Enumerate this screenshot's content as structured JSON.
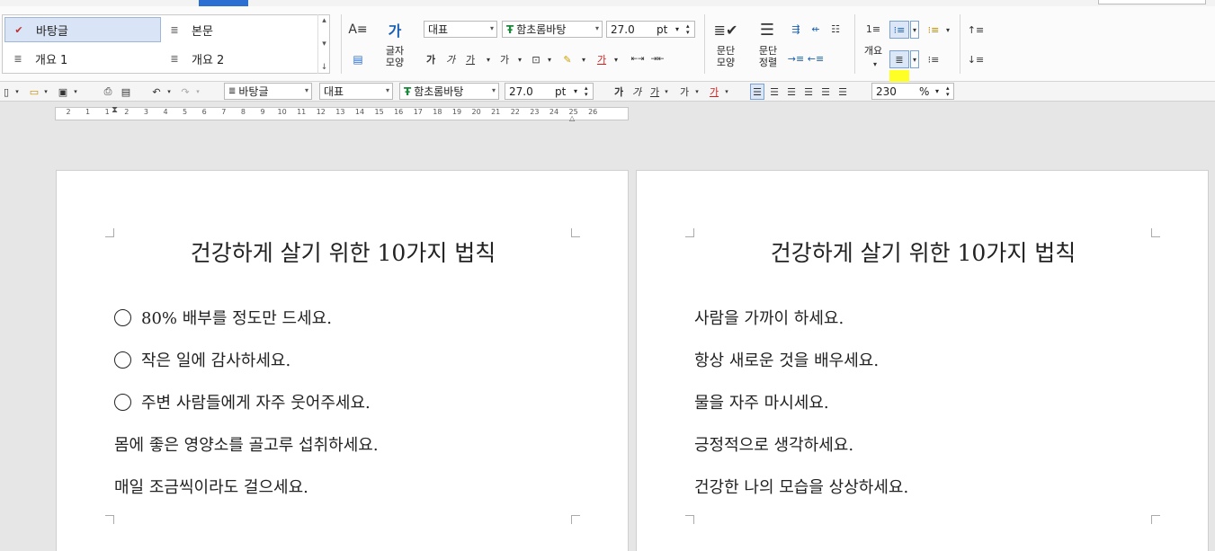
{
  "ribbon": {
    "styles": [
      {
        "label": "바탕글",
        "selected": true,
        "icon": "style-paragraph-icon"
      },
      {
        "label": "본문",
        "selected": false,
        "icon": "style-paragraph-icon"
      },
      {
        "label": "개요 1",
        "selected": false,
        "icon": "style-paragraph-icon"
      },
      {
        "label": "개요 2",
        "selected": false,
        "icon": "style-paragraph-icon"
      }
    ],
    "style_label": "바탕글",
    "language_combo": "대표",
    "font_combo": "함초롬바탕",
    "size_value": "27.0",
    "size_unit": "pt",
    "char_shape_label": "글자\n모양",
    "para_shape_label": "문단\n모양",
    "para_align_label": "문단\n정렬",
    "outline_label": "개요",
    "bold": "가",
    "italic": "가",
    "underline": "가"
  },
  "toolbar2": {
    "style_combo": "바탕글",
    "language_combo": "대표",
    "font_combo": "함초롬바탕",
    "size_value": "27.0",
    "size_unit": "pt",
    "zoom_value": "230",
    "zoom_unit": "%"
  },
  "ruler": {
    "ticks": [
      "2",
      "1",
      "1",
      "2",
      "3",
      "4",
      "5",
      "6",
      "7",
      "8",
      "9",
      "10",
      "11",
      "12",
      "13",
      "14",
      "15",
      "16",
      "17",
      "18",
      "19",
      "20",
      "21",
      "22",
      "23",
      "24",
      "25",
      "26"
    ]
  },
  "pages": [
    {
      "title": "건강하게 살기 위한 10가지 법칙",
      "lines": [
        {
          "text": "80% 배부를 정도만 드세요.",
          "bullet": true
        },
        {
          "text": "작은 일에 감사하세요.",
          "bullet": true
        },
        {
          "text": "주변 사람들에게 자주 웃어주세요.",
          "bullet": true
        },
        {
          "text": "몸에 좋은 영양소를 골고루 섭취하세요.",
          "bullet": false
        },
        {
          "text": "매일 조금씩이라도 걸으세요.",
          "bullet": false
        }
      ]
    },
    {
      "title": "건강하게 살기 위한 10가지 법칙",
      "lines": [
        {
          "text": "사람을 가까이 하세요.",
          "bullet": false
        },
        {
          "text": "항상 새로운 것을 배우세요.",
          "bullet": false
        },
        {
          "text": "물을 자주 마시세요.",
          "bullet": false
        },
        {
          "text": "긍정적으로 생각하세요.",
          "bullet": false
        },
        {
          "text": "건강한 나의 모습을 상상하세요.",
          "bullet": false
        }
      ]
    }
  ],
  "colors": {
    "accent": "#2a6fd1",
    "highlight": "#ffff00",
    "selected_style_bg": "#d9e4f6"
  }
}
